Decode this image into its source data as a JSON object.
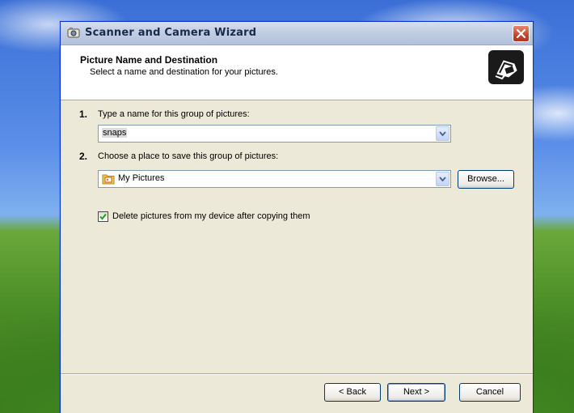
{
  "window": {
    "title": "Scanner and Camera Wizard",
    "icon": "scanner-camera-icon",
    "close_icon": "close-icon"
  },
  "header": {
    "title": "Picture Name and Destination",
    "subtitle": "Select a name and destination for your pictures.",
    "icon": "camera-hand-icon"
  },
  "step1": {
    "number": "1.",
    "label": "Type a name for this group of pictures:",
    "value": "snaps"
  },
  "step2": {
    "number": "2.",
    "label": "Choose a place to save this group of pictures:",
    "value": "My Pictures",
    "browse_label": "Browse..."
  },
  "option": {
    "label": "Delete pictures from my device after copying them",
    "checked": true
  },
  "buttons": {
    "back": "< Back",
    "next": "Next >",
    "cancel": "Cancel"
  },
  "colors": {
    "titlebar_border": "#0831d9",
    "close_button": "#c8432b",
    "dialog_background": "#ece9d8"
  }
}
